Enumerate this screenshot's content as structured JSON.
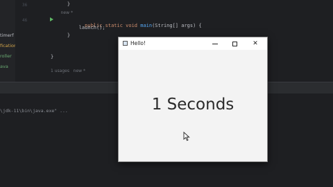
{
  "ide": {
    "line_numbers": [
      "36",
      "",
      "46",
      "",
      "",
      "",
      "",
      "",
      "",
      ""
    ],
    "code_lines": [
      {
        "text": "    }",
        "kind": "plain"
      },
      {
        "text": "    new *",
        "kind": "hint"
      },
      {
        "text": "    public static void main(String[] args) {",
        "kind": "main"
      },
      {
        "text": "        launch();",
        "kind": "plain"
      },
      {
        "text": "    }",
        "kind": "plain"
      },
      {
        "text": "",
        "kind": "plain"
      },
      {
        "text": "",
        "kind": "plain"
      },
      {
        "text": "}",
        "kind": "plain"
      },
      {
        "text": "",
        "kind": "plain"
      },
      {
        "text": "1 usages   new *",
        "kind": "hint"
      }
    ],
    "project_items": [
      {
        "label": "timerf",
        "color": "#bcbec4"
      },
      {
        "label": "fication",
        "color": "#d4a64b"
      },
      {
        "label": "roller",
        "color": "#6aab73"
      },
      {
        "label": "ava",
        "color": "#6aab73"
      }
    ],
    "console_line": "\\jdk-11\\bin\\java.exe\" ..."
  },
  "app": {
    "window_title": "Hello!",
    "minimize_label": "—",
    "maximize_label": "☐",
    "close_label": "✕",
    "counter_text": "1 Seconds"
  },
  "colors": {
    "ide_bg": "#1e1f22",
    "window_bg": "#f3f3f3",
    "run_icon": "#5fb865"
  }
}
